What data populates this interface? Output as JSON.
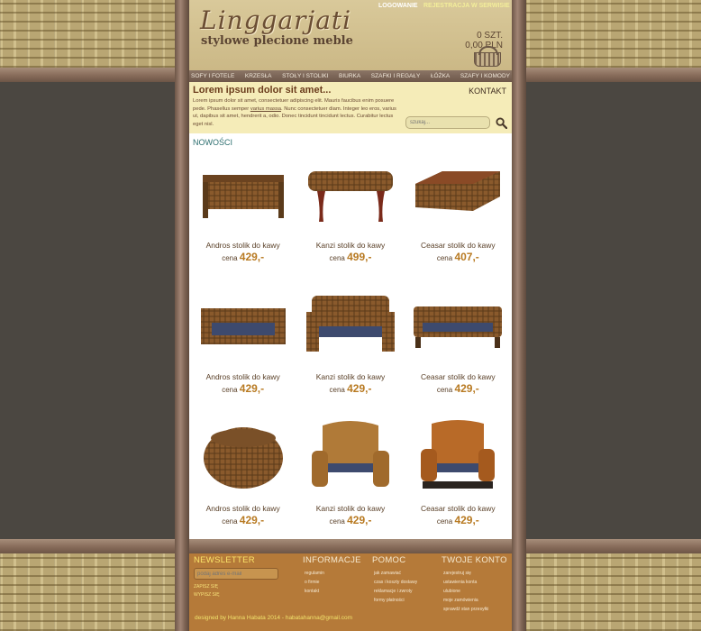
{
  "brand": {
    "logo": "Linggarjati",
    "tagline": "stylowe plecione meble"
  },
  "top_links": {
    "login": "LOGOWANIE",
    "register": "REJESTRACJA W SERWISIE"
  },
  "cart": {
    "count": "0 SZT.",
    "total": "0,00 PLN"
  },
  "nav": [
    "SOFY I FOTELE",
    "KRZESŁA",
    "STOŁY I STOLIKI",
    "BIURKA",
    "SZAFKI I REGAŁY",
    "ŁÓŻKA",
    "SZAFY I KOMODY"
  ],
  "intro": {
    "title": "Lorem ipsum dolor sit amet...",
    "text_before": "Lorem ipsum dolor sit amet, consectetuer adipiscing elit. Mauris faucibus enim posuere pede. Phasellus semper ",
    "link": "varius massa",
    "text_after": ". Nunc consectetuer diam. Integer leo eros, varius ut, dapibus sit amet, hendrerit a, odio. Donec tincidunt tincidunt lectus. Curabitur lectus eget nisl."
  },
  "contact": "KONTAKT",
  "search": {
    "placeholder": "szukaj..."
  },
  "section_title": "NOWOŚCI",
  "products": [
    {
      "name": "Andros stolik do kawy",
      "price_label": "cena",
      "price": "429,-",
      "kind": "table-low"
    },
    {
      "name": "Kanzi stolik do kawy",
      "price_label": "cena",
      "price": "499,-",
      "kind": "bench-legs"
    },
    {
      "name": "Ceasar stolik do kawy",
      "price_label": "cena",
      "price": "407,-",
      "kind": "table-box"
    },
    {
      "name": "Andros stolik do kawy",
      "price_label": "cena",
      "price": "429,-",
      "kind": "sofa-low"
    },
    {
      "name": "Kanzi stolik do kawy",
      "price_label": "cena",
      "price": "429,-",
      "kind": "loveseat"
    },
    {
      "name": "Ceasar stolik do kawy",
      "price_label": "cena",
      "price": "429,-",
      "kind": "sofa-long"
    },
    {
      "name": "Andros stolik do kawy",
      "price_label": "cena",
      "price": "429,-",
      "kind": "pouf"
    },
    {
      "name": "Kanzi stolik do kawy",
      "price_label": "cena",
      "price": "429,-",
      "kind": "armchair"
    },
    {
      "name": "Ceasar stolik do kawy",
      "price_label": "cena",
      "price": "429,-",
      "kind": "armchair-dark"
    }
  ],
  "footer": {
    "newsletter": {
      "title": "NEWSLETTER",
      "placeholder": "podaj adres e-mail",
      "subscribe": "ZAPISZ SIĘ",
      "unsubscribe": "WYPISZ SIĘ"
    },
    "info": {
      "title": "INFORMACJE",
      "items": [
        "regulamin",
        "o firmie",
        "kontakt"
      ]
    },
    "help": {
      "title": "POMOC",
      "items": [
        "jak zamawiać",
        "czas i koszty dostawy",
        "reklamacje i zwroty",
        "formy płatności"
      ]
    },
    "account": {
      "title": "TWOJE KONTO",
      "items": [
        "zarejestruj się",
        "ustawienia konta",
        "ulubione",
        "moje zamówienia",
        "sprawdź stan przesyłki"
      ]
    },
    "credit": "designed by Hanna Habata 2014 - habatahanna@gmail.com"
  },
  "colors": {
    "wicker": "#8a5a2c",
    "cushion": "#3d4a6e",
    "price": "#b87a22",
    "footer": "#b57a39"
  }
}
